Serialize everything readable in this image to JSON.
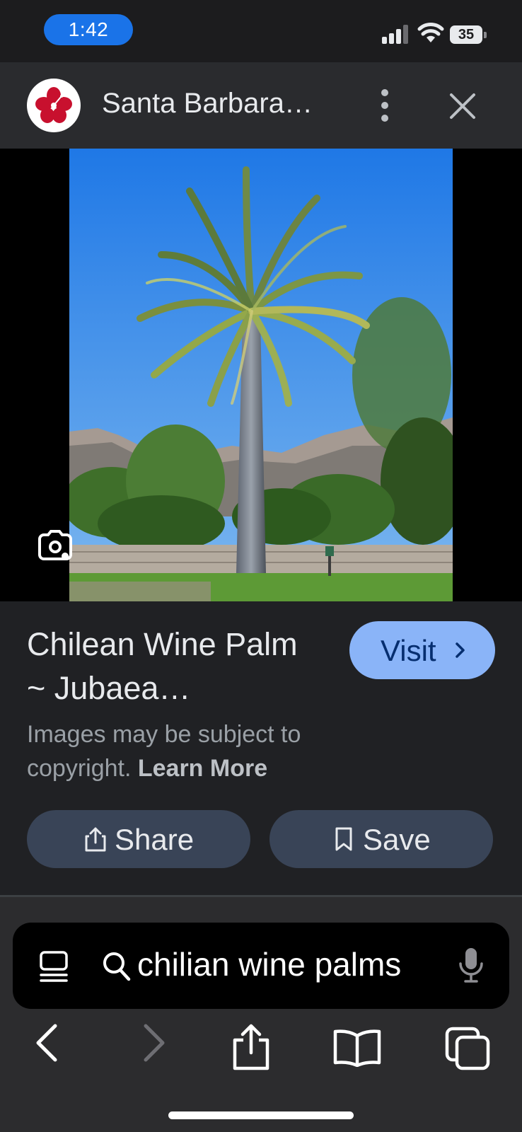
{
  "status_bar": {
    "time": "1:42",
    "battery": "35"
  },
  "header": {
    "site_title": "Santa Barbara…",
    "icon": "hibiscus-logo-icon"
  },
  "image": {
    "description_icon": "lens-icon"
  },
  "result": {
    "title": "Chilean Wine Palm ~ Jubaea…",
    "visit_label": "Visit",
    "copyright_text": "Images may be subject to copyright.",
    "learn_more": "Learn More",
    "share_label": "Share",
    "save_label": "Save"
  },
  "search": {
    "query": "chilian wine palms"
  },
  "colors": {
    "accent": "#8ab4f8",
    "time_pill": "#1a73e8",
    "pill_button": "#394457"
  }
}
